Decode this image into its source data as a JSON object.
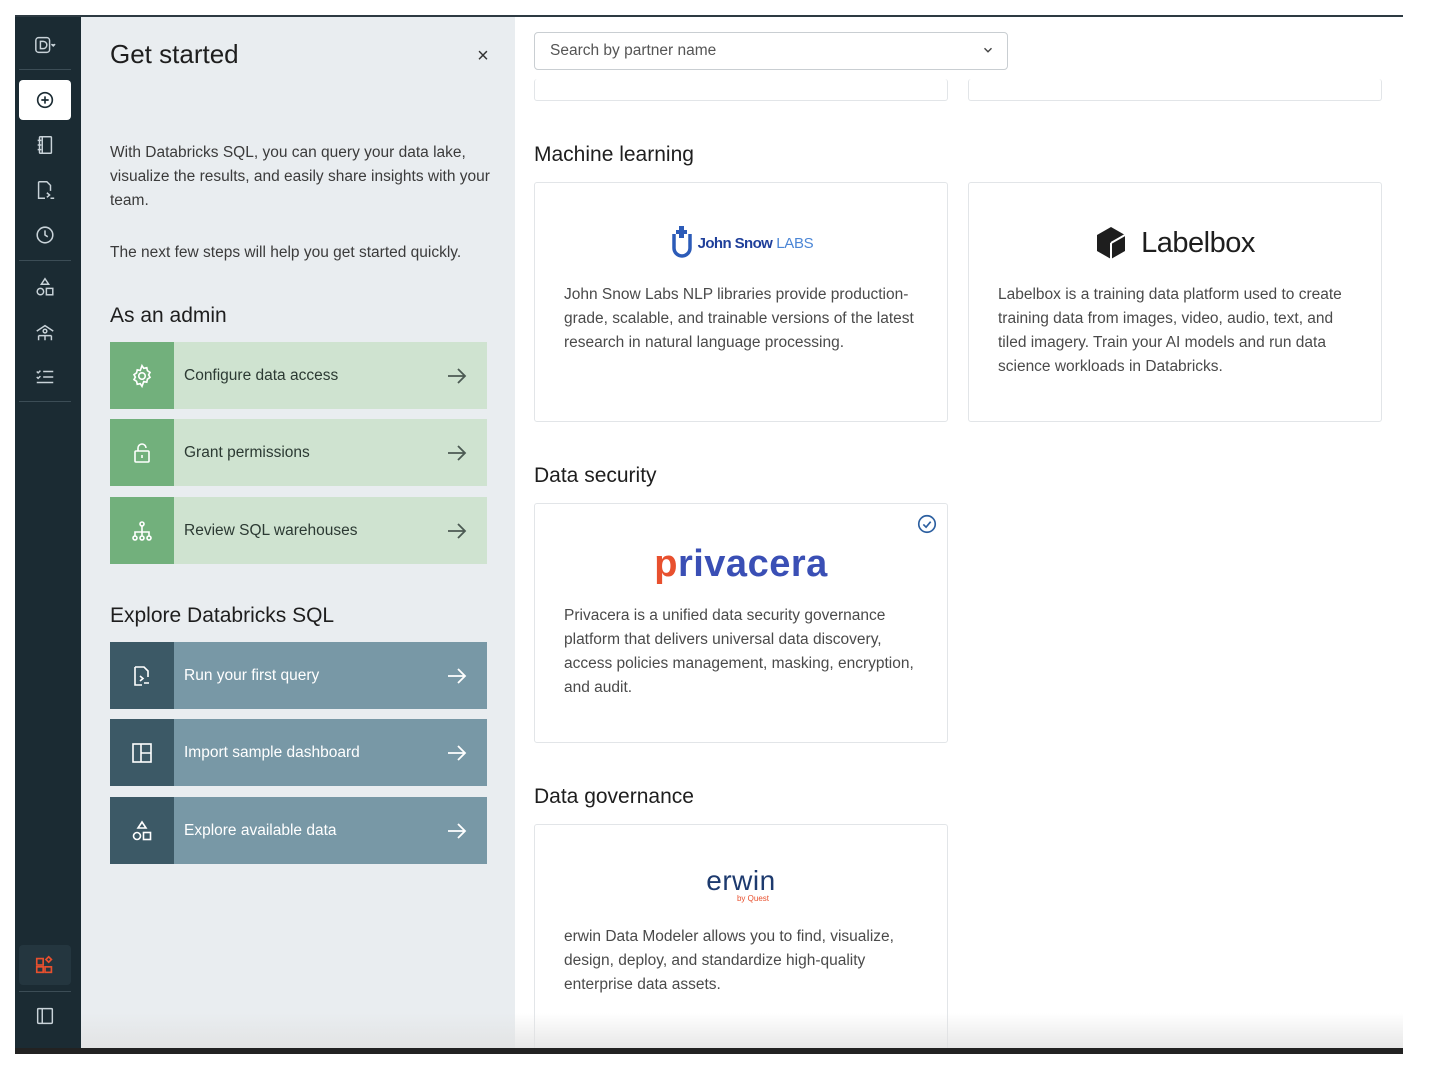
{
  "rail": {
    "items": [
      "workspace-switcher",
      "new",
      "sql-editor",
      "queries",
      "query-history",
      "catalog",
      "warehouses",
      "alerts",
      "partner-connect",
      "sidebar-toggle"
    ]
  },
  "panel": {
    "title": "Get started",
    "close_label": "×",
    "intro": "With Databricks SQL, you can query your data lake, visualize the results, and easily share insights with your team.",
    "next_steps": "The next few steps will help you get started quickly.",
    "admin_heading": "As an admin",
    "admin_steps": [
      {
        "label": "Configure data access",
        "icon": "gear-icon"
      },
      {
        "label": "Grant permissions",
        "icon": "lock-icon"
      },
      {
        "label": "Review SQL warehouses",
        "icon": "hierarchy-icon"
      }
    ],
    "explore_heading": "Explore Databricks SQL",
    "explore_steps": [
      {
        "label": "Run your first query",
        "icon": "query-file-icon"
      },
      {
        "label": "Import sample dashboard",
        "icon": "dashboard-icon"
      },
      {
        "label": "Explore available data",
        "icon": "shapes-icon"
      }
    ]
  },
  "main": {
    "search_placeholder": "Search by partner name",
    "sections": [
      {
        "heading": "Machine learning",
        "cards": [
          {
            "logo": "John Snow LABS",
            "logo_a": "John Snow",
            "logo_b": "LABS",
            "desc": "John Snow Labs NLP libraries provide production-grade, scalable, and trainable versions of the latest research in natural language processing."
          },
          {
            "logo": "Labelbox",
            "desc": "Labelbox is a training data platform used to create training data from images, video, audio, text, and tiled imagery. Train your AI models and run data science workloads in Databricks."
          }
        ]
      },
      {
        "heading": "Data security",
        "cards": [
          {
            "logo": "privacera",
            "connected": true,
            "desc": "Privacera is a unified data security governance platform that delivers universal data discovery, access policies management, masking, encryption, and audit."
          }
        ]
      },
      {
        "heading": "Data governance",
        "cards": [
          {
            "logo": "erwin",
            "logo_sub": "by Quest",
            "desc": "erwin Data Modeler allows you to find, visualize, design, deploy, and standardize high-quality enterprise data assets."
          }
        ]
      }
    ]
  },
  "colors": {
    "rail_bg": "#1b2b33",
    "panel_bg": "#e9edf0",
    "admin_step_bg": "#cfe3d0",
    "admin_icon_bg": "#72b07c",
    "explore_step_bg": "#7898a6",
    "explore_icon_bg": "#3c5966",
    "privacera_accent": "#e8502e",
    "privacera_main": "#3a4fb5",
    "johnsnow_blue": "#2c5bb8"
  }
}
